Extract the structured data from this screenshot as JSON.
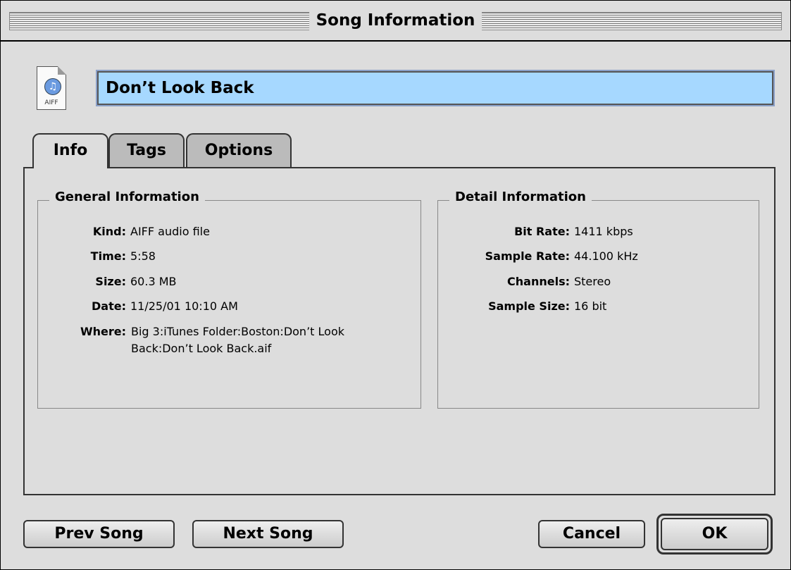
{
  "window": {
    "title": "Song Information"
  },
  "file": {
    "icon": "aiff-file-icon",
    "type_label": "AIFF",
    "song_name": "Don’t Look Back"
  },
  "tabs": [
    {
      "label": "Info",
      "active": true
    },
    {
      "label": "Tags",
      "active": false
    },
    {
      "label": "Options",
      "active": false
    }
  ],
  "general": {
    "title": "General Information",
    "kind_label": "Kind:",
    "kind": "AIFF audio file",
    "time_label": "Time:",
    "time": "5:58",
    "size_label": "Size:",
    "size": "60.3 MB",
    "date_label": "Date:",
    "date": "11/25/01 10:10 AM",
    "where_label": "Where:",
    "where": "Big 3:iTunes Folder:Boston:Don’t Look Back:Don’t Look Back.aif"
  },
  "detail": {
    "title": "Detail Information",
    "bit_rate_label": "Bit Rate:",
    "bit_rate": "1411 kbps",
    "sample_rate_label": "Sample Rate:",
    "sample_rate": "44.100 kHz",
    "channels_label": "Channels:",
    "channels": "Stereo",
    "sample_size_label": "Sample Size:",
    "sample_size": "16 bit"
  },
  "buttons": {
    "prev": "Prev Song",
    "next": "Next Song",
    "cancel": "Cancel",
    "ok": "OK"
  }
}
